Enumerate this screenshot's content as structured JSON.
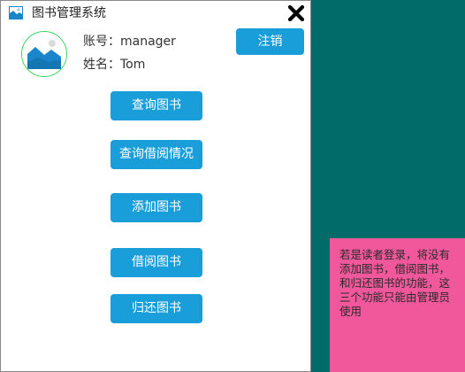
{
  "window": {
    "title": "图书管理系统",
    "app_icon": "image-icon",
    "close_icon": "close-x-icon"
  },
  "user": {
    "account_line": "账号：manager",
    "name_line": "姓名：Tom",
    "avatar_icon": "image-placeholder-icon"
  },
  "buttons": {
    "logout": "注销",
    "query_books": "查询图书",
    "query_borrow": "查询借阅情况",
    "add_book": "添加图书",
    "borrow_book": "借阅图书",
    "return_book": "归还图书"
  },
  "note": {
    "text": "若是读者登录，将没有添加图书，借阅图书，和归还图书的功能，这三个功能只能由管理员使用"
  },
  "colors": {
    "desktop": "#006b68",
    "button": "#1a9ed9",
    "note_background": "#f0589b",
    "avatar_ring": "#33d35a"
  }
}
